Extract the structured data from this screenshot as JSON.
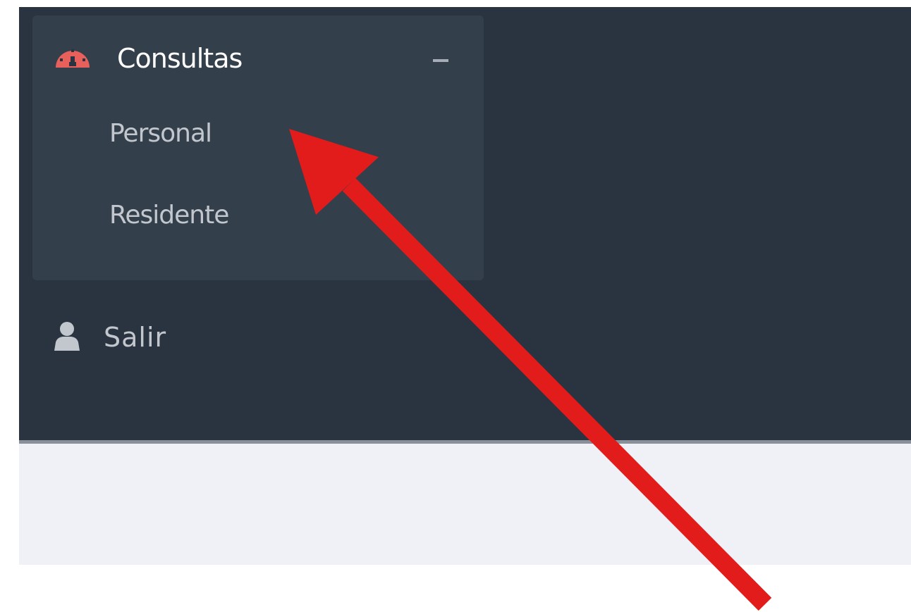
{
  "menu": {
    "header": {
      "label": "Consultas",
      "icon": "dashboard-icon",
      "collapse_icon": "minus-icon",
      "icon_color": "#e8605c"
    },
    "items": [
      {
        "label": "Personal"
      },
      {
        "label": "Residente"
      }
    ]
  },
  "logout": {
    "label": "Salir",
    "icon": "user-icon"
  },
  "annotation": {
    "type": "arrow",
    "color": "#e21b1b",
    "target": "Personal"
  },
  "colors": {
    "sidebar_bg": "#2a3440",
    "submenu_bg": "#343f4c",
    "content_bg": "#f0f1f6",
    "text_primary": "#ffffff",
    "text_secondary": "#c2c7ce"
  }
}
